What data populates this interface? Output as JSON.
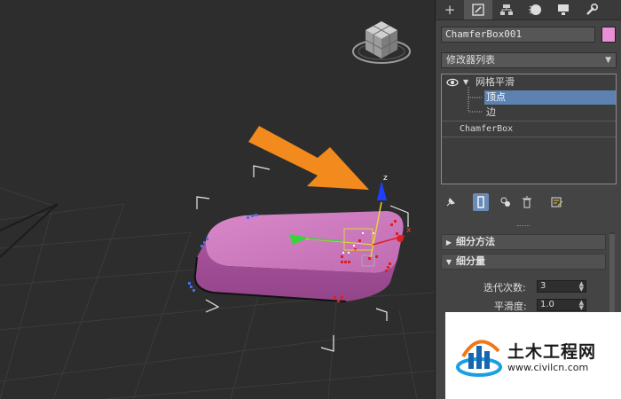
{
  "command_panel": {
    "tabs": [
      {
        "icon": "plus-icon",
        "glyph": "+"
      },
      {
        "icon": "modify-icon",
        "glyph": "◩"
      },
      {
        "icon": "hierarchy-icon",
        "glyph": "♖"
      },
      {
        "icon": "motion-icon",
        "glyph": "●"
      },
      {
        "icon": "display-icon",
        "glyph": "▀"
      },
      {
        "icon": "utilities-icon",
        "glyph": "🔧"
      }
    ],
    "object_name": "ChamferBox001",
    "object_color": "#e98fd5",
    "modifier_list_label": "修改器列表",
    "stack": {
      "modifier": "网格平滑",
      "sub_vertex": "顶点",
      "sub_edge": "边",
      "base_object": "ChamferBox"
    },
    "rollouts": {
      "subdivision_method": "细分方法",
      "subdivision_amount": "细分量",
      "iterations_label": "迭代次数:",
      "iterations_value": "3",
      "smoothness_label": "平滑度:",
      "smoothness_value": "1.0"
    }
  },
  "viewport": {
    "gizmo_axis_z": "z",
    "gizmo_axis_x": "x",
    "object_color": "#c974bc"
  },
  "watermark": {
    "title": "土木工程网",
    "url": "www.civilcn.com"
  }
}
